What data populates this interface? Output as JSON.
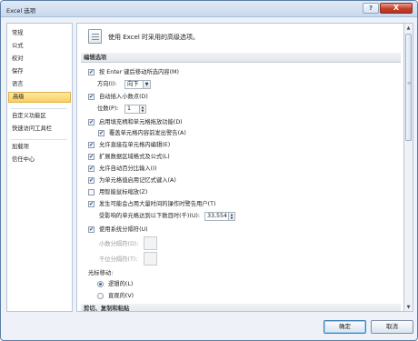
{
  "window": {
    "title": "Excel 选项",
    "help_label": "?",
    "close_label": "X"
  },
  "nav": {
    "items": [
      {
        "label": "常规"
      },
      {
        "label": "公式"
      },
      {
        "label": "校对"
      },
      {
        "label": "保存"
      },
      {
        "label": "语言"
      },
      {
        "label": "高级"
      },
      {
        "label": "自定义功能区"
      },
      {
        "label": "快速访问工具栏"
      },
      {
        "label": "加载项"
      },
      {
        "label": "信任中心"
      }
    ],
    "selected": "高级"
  },
  "content": {
    "header_text": "使用 Excel 时采用的高级选项。",
    "edit_section": {
      "title": "编辑选项",
      "move_after_enter": {
        "label": "按 Enter 键后移动所选内容(M)",
        "checked": true
      },
      "direction": {
        "label": "方向(I):",
        "value": "向下"
      },
      "auto_decimal": {
        "label": "自动插入小数点(D)",
        "checked": true
      },
      "places": {
        "label": "位数(P):",
        "value": "1"
      },
      "fill_handle": {
        "label": "启用填充柄和单元格拖放功能(D)",
        "checked": true
      },
      "alert_overwrite": {
        "label": "覆盖单元格内容前发出警告(A)",
        "checked": true
      },
      "edit_in_cell": {
        "label": "允许直接在单元格内编辑(E)",
        "checked": true
      },
      "extend_formats": {
        "label": "扩展数据区域格式及公式(L)",
        "checked": true
      },
      "auto_percent": {
        "label": "允许自动百分比输入(I)",
        "checked": true
      },
      "autocomplete": {
        "label": "为单元格值启用记忆式键入(A)",
        "checked": true
      },
      "intellimouse_zoom": {
        "label": "用智能鼠标缩放(Z)",
        "checked": false
      },
      "alert_slow": {
        "label": "发生可能会占用大量时间的操作时警告用户(T)",
        "checked": true
      },
      "cells_affected": {
        "label": "受影响的单元格达到以下数目时(千)(U):",
        "value": "33,554"
      },
      "system_separators": {
        "label": "使用系统分隔符(U)",
        "checked": true
      },
      "decimal_separator": {
        "label": "小数分隔符(D):",
        "value": ""
      },
      "thousands_separator": {
        "label": "千位分隔符(T):",
        "value": ""
      },
      "cursor_movement": {
        "label": "光标移动:",
        "logical": {
          "label": "逻辑的(L)",
          "selected": true
        },
        "visual": {
          "label": "直观的(V)",
          "selected": false
        }
      }
    },
    "cut_section": {
      "title": "剪切、复制和粘贴"
    }
  },
  "footer": {
    "ok_label": "确定",
    "cancel_label": "取消"
  },
  "colors": {
    "selected_nav": "#f9cf60",
    "close_button": "#c4402a",
    "checkbox_tick": "#1d4e8a"
  }
}
